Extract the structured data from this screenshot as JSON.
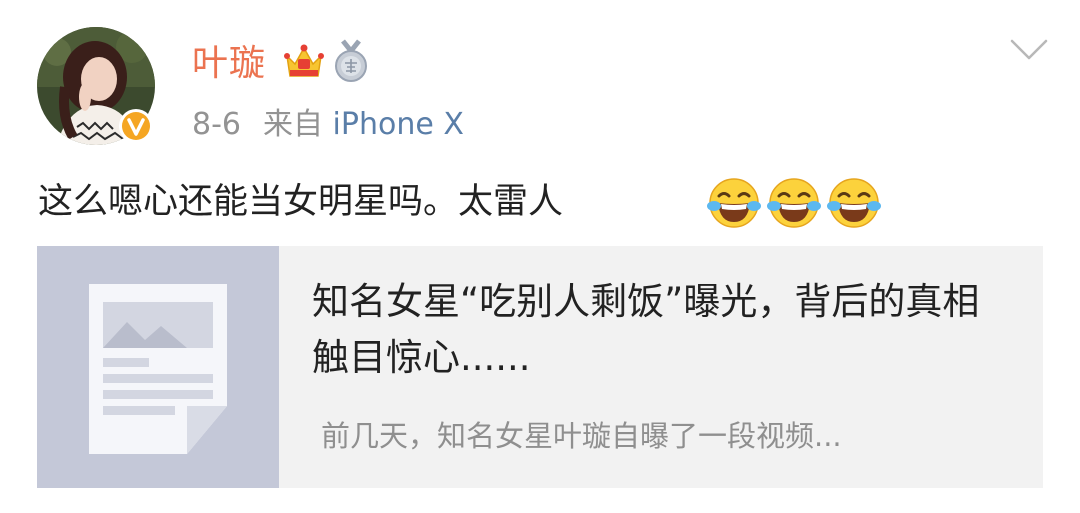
{
  "post": {
    "username": "叶璇",
    "date": "8-6",
    "source_prefix": "来自",
    "source_device": "iPhone X",
    "text": "这么嗯心还能当女明星吗。太雷人",
    "emoji_count": 3,
    "icons": {
      "avatar": "avatar",
      "verified": "verified-badge-icon",
      "crown": "crown-icon",
      "medal": "medal-icon",
      "menu": "chevron-down-icon",
      "emoji": "laugh-cry-emoji-icon"
    },
    "colors": {
      "username": "#eb7350",
      "device": "#5a7ea8",
      "meta": "#939393",
      "card_background": "#f2f2f2",
      "thumbnail": "#c4c8d8"
    }
  },
  "card": {
    "title": "知名女星“吃别人剩饭”曝光，背后的真相触目惊心......",
    "summary": "前几天，知名女星叶璇自曝了一段视频..."
  }
}
